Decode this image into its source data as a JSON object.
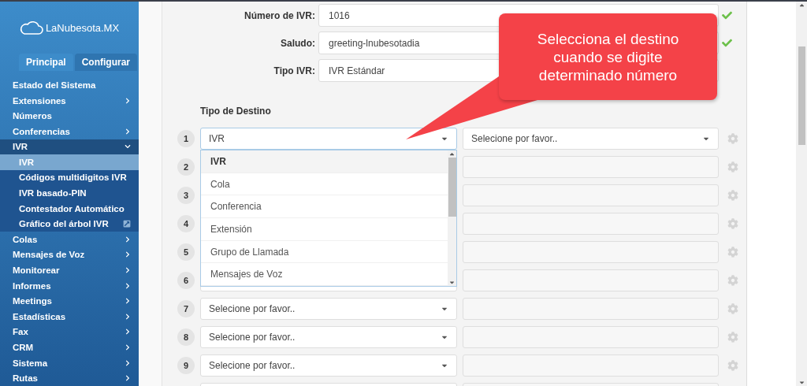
{
  "sidebar": {
    "logo": "LaNubesota.MX",
    "tabs": [
      {
        "label": "Principal",
        "selected": true
      },
      {
        "label": "Configurar",
        "selected": false
      }
    ],
    "items": [
      {
        "label": "Estado del Sistema",
        "kind": "link",
        "selected": false
      },
      {
        "label": "Extensiones",
        "kind": "group",
        "expanded": false,
        "selected": false
      },
      {
        "label": "Números",
        "kind": "link",
        "selected": false
      },
      {
        "label": "Conferencias",
        "kind": "group",
        "expanded": false,
        "selected": false
      },
      {
        "label": "IVR",
        "kind": "group",
        "expanded": true,
        "selected": false,
        "children": [
          {
            "label": "IVR",
            "kind": "link",
            "selected": true
          },
          {
            "label": "Códigos multidigitos IVR",
            "kind": "link",
            "selected": false
          },
          {
            "label": "IVR basado-PIN",
            "kind": "link",
            "selected": false
          },
          {
            "label": "Contestador Automático",
            "kind": "link",
            "selected": false
          },
          {
            "label": "Gráfico del árbol IVR",
            "kind": "external",
            "selected": false
          }
        ]
      },
      {
        "label": "Colas",
        "kind": "group",
        "expanded": false,
        "selected": false
      },
      {
        "label": "Mensajes de Voz",
        "kind": "group",
        "expanded": false,
        "selected": false
      },
      {
        "label": "Monitorear",
        "kind": "group",
        "expanded": false,
        "selected": false
      },
      {
        "label": "Informes",
        "kind": "group",
        "expanded": false,
        "selected": false
      },
      {
        "label": "Meetings",
        "kind": "group",
        "expanded": false,
        "selected": false
      },
      {
        "label": "Estadísticas",
        "kind": "group",
        "expanded": false,
        "selected": false
      },
      {
        "label": "Fax",
        "kind": "group",
        "expanded": false,
        "selected": false
      },
      {
        "label": "CRM",
        "kind": "group",
        "expanded": false,
        "selected": false
      },
      {
        "label": "Sistema",
        "kind": "group",
        "expanded": false,
        "selected": false
      },
      {
        "label": "Rutas",
        "kind": "group",
        "expanded": false,
        "selected": false
      }
    ]
  },
  "form": {
    "fields": [
      {
        "label": "Número de IVR:",
        "value": "1016",
        "valid": true
      },
      {
        "label": "Saludo:",
        "value": "greeting-lnubesotadia",
        "valid": true
      },
      {
        "label": "Tipo IVR:",
        "value": "IVR Estándar"
      }
    ]
  },
  "destinations": {
    "heading": "Tipo de Destino",
    "dropdown": {
      "options": [
        {
          "label": "IVR",
          "selected": true
        },
        {
          "label": "Cola",
          "selected": false
        },
        {
          "label": "Conferencia",
          "selected": false
        },
        {
          "label": "Extensión",
          "selected": false
        },
        {
          "label": "Grupo de Llamada",
          "selected": false
        },
        {
          "label": "Mensajes de Voz",
          "selected": false
        }
      ]
    },
    "rows": [
      {
        "number": "1",
        "type": "IVR",
        "destination": "Selecione por favor..",
        "disabled": false,
        "open": true
      },
      {
        "number": "2",
        "disabled": true,
        "open": false
      },
      {
        "number": "3",
        "disabled": true,
        "open": false
      },
      {
        "number": "4",
        "disabled": true,
        "open": false
      },
      {
        "number": "5",
        "disabled": true,
        "open": false
      },
      {
        "number": "6",
        "disabled": true,
        "open": false
      },
      {
        "number": "7",
        "type": "Selecione por favor..",
        "disabled": true,
        "open": false
      },
      {
        "number": "8",
        "type": "Selecione por favor..",
        "disabled": true,
        "open": false
      },
      {
        "number": "9",
        "type": "Selecione por favor..",
        "disabled": true,
        "open": false
      },
      {
        "open": false
      }
    ]
  },
  "callout": {
    "text": "Selecciona el destino cuando se digite determinado número"
  }
}
